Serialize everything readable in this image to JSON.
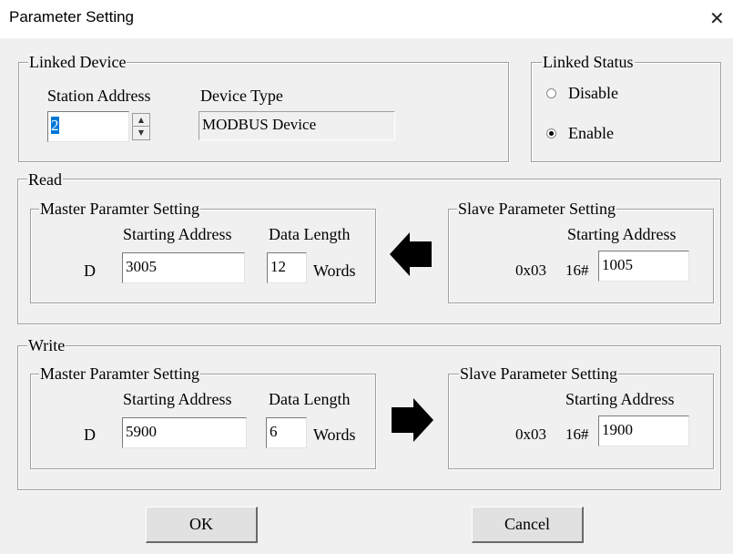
{
  "window": {
    "title": "Parameter Setting",
    "close_glyph": "✕"
  },
  "linked_device": {
    "legend": "Linked Device",
    "station_address_label": "Station Address",
    "station_address_value": "2",
    "device_type_label": "Device Type",
    "device_type_value": "MODBUS Device"
  },
  "linked_status": {
    "legend": "Linked Status",
    "options": [
      "Disable",
      "Enable"
    ],
    "selected": "Enable"
  },
  "read": {
    "legend": "Read",
    "master": {
      "legend": "Master Paramter Setting",
      "starting_address_label": "Starting Address",
      "data_length_label": "Data Length",
      "device_prefix": "D",
      "starting_address": "3005",
      "data_length": "12",
      "unit": "Words"
    },
    "arrow_direction": "left",
    "slave": {
      "legend": "Slave Parameter Setting",
      "starting_address_label": "Starting Address",
      "function_code": "0x03",
      "hex_prefix": "16#",
      "starting_address": "1005"
    }
  },
  "write": {
    "legend": "Write",
    "master": {
      "legend": "Master Paramter Setting",
      "starting_address_label": "Starting Address",
      "data_length_label": "Data Length",
      "device_prefix": "D",
      "starting_address": "5900",
      "data_length": "6",
      "unit": "Words"
    },
    "arrow_direction": "right",
    "slave": {
      "legend": "Slave Parameter Setting",
      "starting_address_label": "Starting Address",
      "function_code": "0x03",
      "hex_prefix": "16#",
      "starting_address": "1900"
    }
  },
  "buttons": {
    "ok": "OK",
    "cancel": "Cancel"
  }
}
